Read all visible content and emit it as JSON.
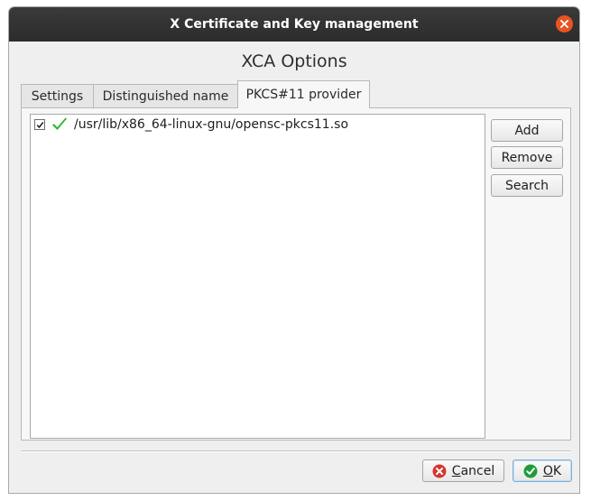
{
  "window": {
    "title": "X Certificate and Key management"
  },
  "dialog": {
    "heading": "XCA Options",
    "tabs": [
      {
        "label": "Settings",
        "active": false
      },
      {
        "label": "Distinguished name",
        "active": false
      },
      {
        "label": "PKCS#11 provider",
        "active": true
      }
    ],
    "providers": [
      {
        "path": "/usr/lib/x86_64-linux-gnu/opensc-pkcs11.so",
        "checked": true,
        "status_icon": "green-check-icon"
      }
    ],
    "side_buttons": {
      "add": "Add",
      "remove": "Remove",
      "search": "Search"
    },
    "footer": {
      "cancel": "Cancel",
      "ok": "OK"
    }
  },
  "colors": {
    "titlebar": "#2c2c2c",
    "close_button": "#e95420",
    "check_green": "#2fb62f",
    "cancel_icon": "#d9342b",
    "ok_icon": "#1f9b3a"
  }
}
